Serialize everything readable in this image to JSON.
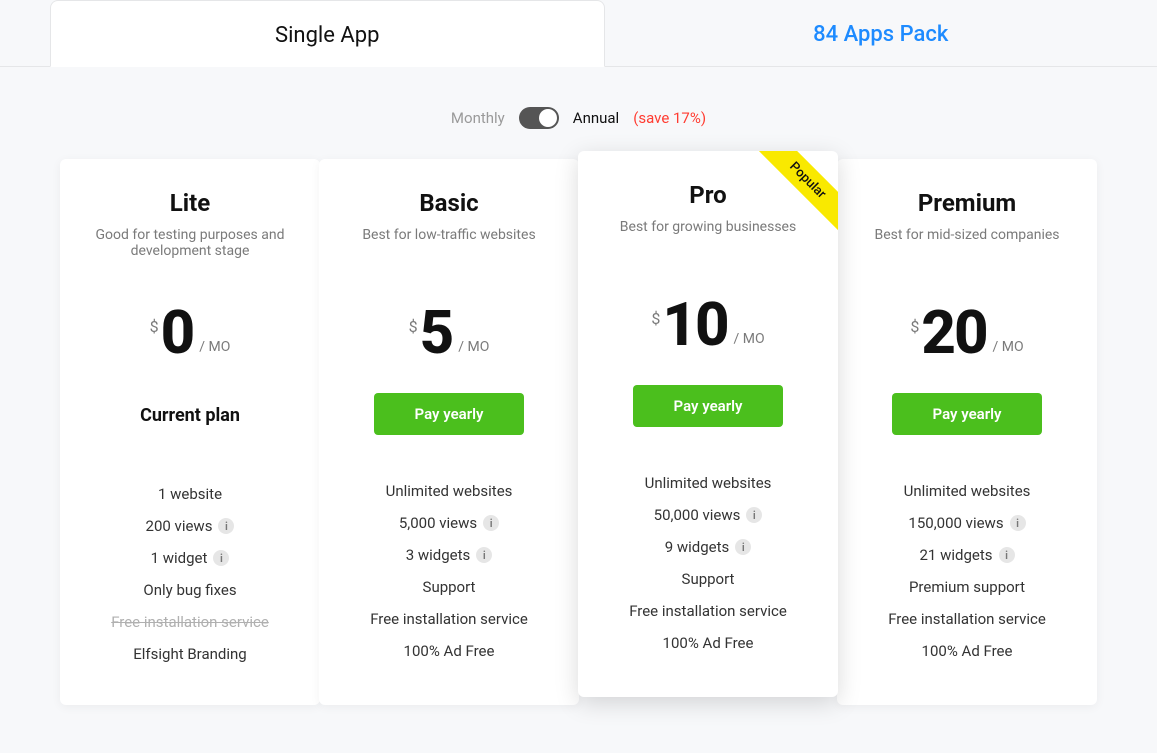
{
  "tabs": {
    "single": "Single App",
    "pack": "84 Apps Pack"
  },
  "billing": {
    "monthly": "Monthly",
    "annual": "Annual",
    "save": "(save 17%)"
  },
  "popular_label": "Popular",
  "plans": [
    {
      "name": "Lite",
      "tagline": "Good for testing purposes and development stage",
      "currency": "$",
      "amount": "0",
      "period": "/ MO",
      "cta": "Current plan",
      "cta_type": "current",
      "features": [
        {
          "text": "1 website",
          "info": false,
          "strike": false
        },
        {
          "text": "200 views",
          "info": true,
          "strike": false
        },
        {
          "text": "1 widget",
          "info": true,
          "strike": false
        },
        {
          "text": "Only bug fixes",
          "info": false,
          "strike": false
        },
        {
          "text": "Free installation service",
          "info": false,
          "strike": true
        },
        {
          "text": "Elfsight Branding",
          "info": false,
          "strike": false
        }
      ]
    },
    {
      "name": "Basic",
      "tagline": "Best for low-traffic websites",
      "currency": "$",
      "amount": "5",
      "period": "/ MO",
      "cta": "Pay yearly",
      "cta_type": "pay",
      "features": [
        {
          "text": "Unlimited websites",
          "info": false,
          "strike": false
        },
        {
          "text": "5,000 views",
          "info": true,
          "strike": false
        },
        {
          "text": "3 widgets",
          "info": true,
          "strike": false
        },
        {
          "text": "Support",
          "info": false,
          "strike": false
        },
        {
          "text": "Free installation service",
          "info": false,
          "strike": false
        },
        {
          "text": "100% Ad Free",
          "info": false,
          "strike": false
        }
      ]
    },
    {
      "name": "Pro",
      "tagline": "Best for growing businesses",
      "currency": "$",
      "amount": "10",
      "period": "/ MO",
      "cta": "Pay yearly",
      "cta_type": "pay",
      "popular": true,
      "features": [
        {
          "text": "Unlimited websites",
          "info": false,
          "strike": false
        },
        {
          "text": "50,000 views",
          "info": true,
          "strike": false
        },
        {
          "text": "9 widgets",
          "info": true,
          "strike": false
        },
        {
          "text": "Support",
          "info": false,
          "strike": false
        },
        {
          "text": "Free installation service",
          "info": false,
          "strike": false
        },
        {
          "text": "100% Ad Free",
          "info": false,
          "strike": false
        }
      ]
    },
    {
      "name": "Premium",
      "tagline": "Best for mid-sized companies",
      "currency": "$",
      "amount": "20",
      "period": "/ MO",
      "cta": "Pay yearly",
      "cta_type": "pay",
      "features": [
        {
          "text": "Unlimited websites",
          "info": false,
          "strike": false
        },
        {
          "text": "150,000 views",
          "info": true,
          "strike": false
        },
        {
          "text": "21 widgets",
          "info": true,
          "strike": false
        },
        {
          "text": "Premium support",
          "info": false,
          "strike": false
        },
        {
          "text": "Free installation service",
          "info": false,
          "strike": false
        },
        {
          "text": "100% Ad Free",
          "info": false,
          "strike": false
        }
      ]
    }
  ]
}
